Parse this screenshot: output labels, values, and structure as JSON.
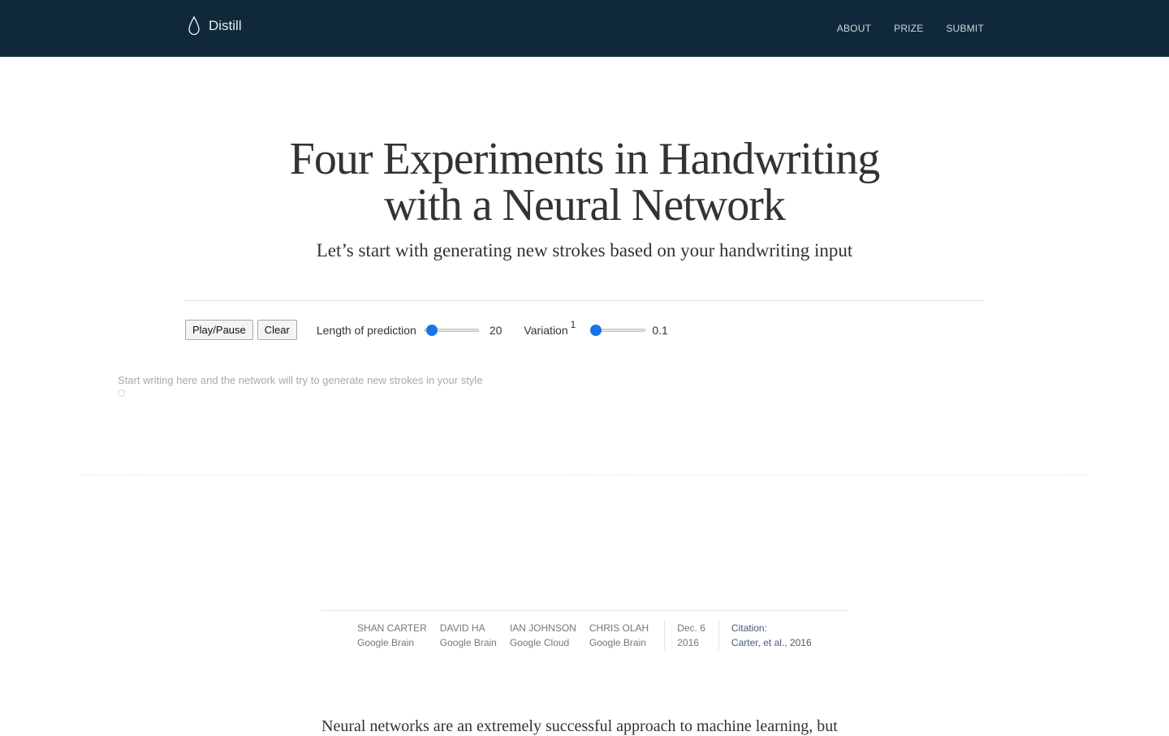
{
  "topbar": {
    "brand": "Distill",
    "nav": [
      "ABOUT",
      "PRIZE",
      "SUBMIT"
    ]
  },
  "article": {
    "title_line1": "Four Experiments in Handwriting",
    "title_line2": "with a Neural Network",
    "subtitle": "Let’s start with generating new strokes based on your handwriting input"
  },
  "controls": {
    "play_pause_label": "Play/Pause",
    "clear_label": "Clear",
    "length_label": "Length of prediction",
    "length_value": "20",
    "length_fraction": 0.05,
    "variation_label": "Variation",
    "variation_footnote": "1",
    "variation_value": "0.1",
    "variation_fraction": 0.0
  },
  "canvas": {
    "hint": "Start writing here and the network will try to generate new strokes in your style"
  },
  "byline": {
    "authors": [
      {
        "name": "Shan Carter",
        "affiliation": "Google Brain"
      },
      {
        "name": "David Ha",
        "affiliation": "Google Brain"
      },
      {
        "name": "Ian Johnson",
        "affiliation": "Google Cloud"
      },
      {
        "name": "Chris Olah",
        "affiliation": "Google Brain"
      }
    ],
    "date_line1": "Dec. 6",
    "date_line2": "2016",
    "citation_label": "Citation:",
    "citation_text": "Carter, et al., 2016"
  },
  "body": {
    "first_line": "Neural networks are an extremely successful approach to machine learning, but"
  },
  "colors": {
    "topbar_bg": "#10293a",
    "slider_thumb": "#1a73e8"
  },
  "icons": {
    "brand": "droplet-icon"
  }
}
